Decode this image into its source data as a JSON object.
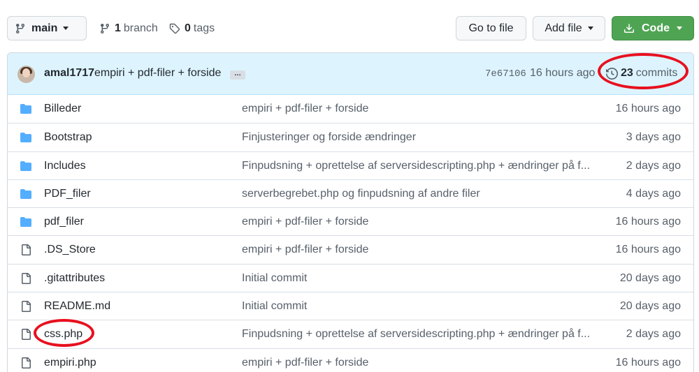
{
  "toolbar": {
    "branch_label": "main",
    "branches_count": "1",
    "branches_label": "branch",
    "tags_count": "0",
    "tags_label": "tags",
    "goto_label": "Go to file",
    "add_label": "Add file",
    "code_label": "Code"
  },
  "commit": {
    "author": "amal1717",
    "message": "empiri + pdf-filer + forside",
    "ellipsis": "…",
    "sha": "7e67106",
    "time": "16 hours ago",
    "commits_count": "23",
    "commits_label": "commits"
  },
  "files": [
    {
      "type": "dir",
      "name": "Billeder",
      "message": "empiri + pdf-filer + forside",
      "age": "16 hours ago"
    },
    {
      "type": "dir",
      "name": "Bootstrap",
      "message": "Finjusteringer og forside ændringer",
      "age": "3 days ago"
    },
    {
      "type": "dir",
      "name": "Includes",
      "message": "Finpudsning + oprettelse af serversidescripting.php + ændringer på f...",
      "age": "2 days ago"
    },
    {
      "type": "dir",
      "name": "PDF_filer",
      "message": "serverbegrebet.php og finpudsning af andre filer",
      "age": "4 days ago"
    },
    {
      "type": "dir",
      "name": "pdf_filer",
      "message": "empiri + pdf-filer + forside",
      "age": "16 hours ago"
    },
    {
      "type": "file",
      "name": ".DS_Store",
      "message": "empiri + pdf-filer + forside",
      "age": "16 hours ago"
    },
    {
      "type": "file",
      "name": ".gitattributes",
      "message": "Initial commit",
      "age": "20 days ago"
    },
    {
      "type": "file",
      "name": "README.md",
      "message": "Initial commit",
      "age": "20 days ago"
    },
    {
      "type": "file",
      "name": "css.php",
      "message": "Finpudsning + oprettelse af serversidescripting.php + ændringer på f...",
      "age": "2 days ago"
    },
    {
      "type": "file",
      "name": "empiri.php",
      "message": "empiri + pdf-filer + forside",
      "age": "16 hours ago"
    }
  ],
  "colors": {
    "folder": "#54aeff",
    "annotation": "#e8101e",
    "code_button": "#4fa453"
  }
}
